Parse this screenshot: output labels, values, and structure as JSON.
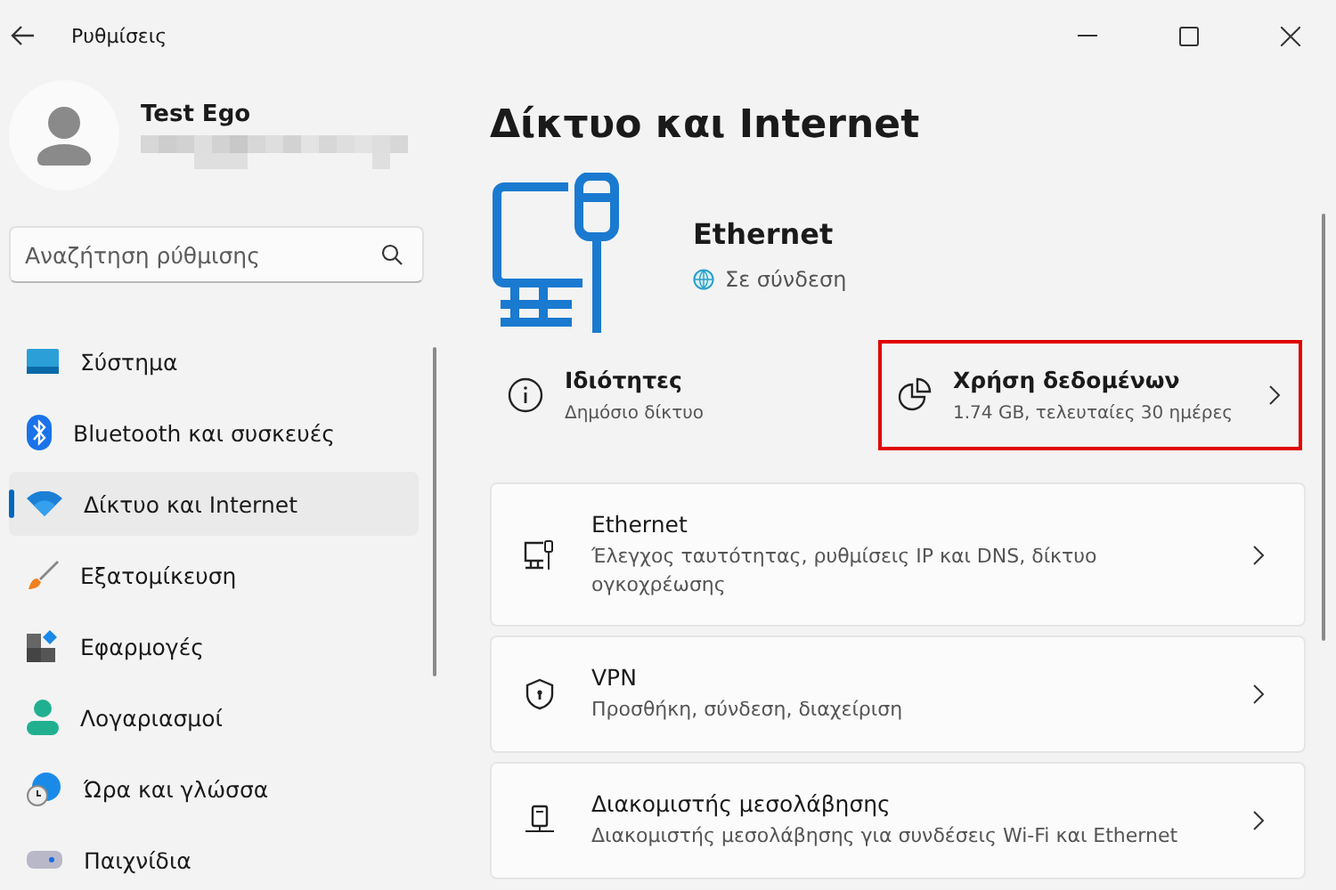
{
  "window": {
    "title": "Ρυθμίσεις"
  },
  "user": {
    "name": "Test Ego"
  },
  "search": {
    "placeholder": "Αναζήτηση ρύθμισης"
  },
  "sidebar": {
    "items": [
      {
        "label": "Σύστημα",
        "selected": false
      },
      {
        "label": "Bluetooth και συσκευές",
        "selected": false
      },
      {
        "label": "Δίκτυο και Internet",
        "selected": true
      },
      {
        "label": "Εξατομίκευση",
        "selected": false
      },
      {
        "label": "Εφαρμογές",
        "selected": false
      },
      {
        "label": "Λογαριασμοί",
        "selected": false
      },
      {
        "label": "Ώρα και γλώσσα",
        "selected": false
      },
      {
        "label": "Παιχνίδια",
        "selected": false
      }
    ]
  },
  "page": {
    "title": "Δίκτυο και Internet"
  },
  "connection": {
    "name": "Ethernet",
    "status": "Σε σύνδεση"
  },
  "summary_cards": [
    {
      "title": "Ιδιότητες",
      "subtitle": "Δημόσιο δίκτυο",
      "highlighted": false
    },
    {
      "title": "Χρήση δεδομένων",
      "subtitle": "1.74 GB, τελευταίες 30 ημέρες",
      "highlighted": true
    }
  ],
  "settings": [
    {
      "title": "Ethernet",
      "subtitle": "Έλεγχος ταυτότητας, ρυθμίσεις IP και DNS, δίκτυο ογκοχρέωσης"
    },
    {
      "title": "VPN",
      "subtitle": "Προσθήκη, σύνδεση, διαχείριση"
    },
    {
      "title": "Διακομιστής μεσολάβησης",
      "subtitle": "Διακομιστής μεσολάβησης για συνδέσεις Wi-Fi και Ethernet"
    }
  ]
}
